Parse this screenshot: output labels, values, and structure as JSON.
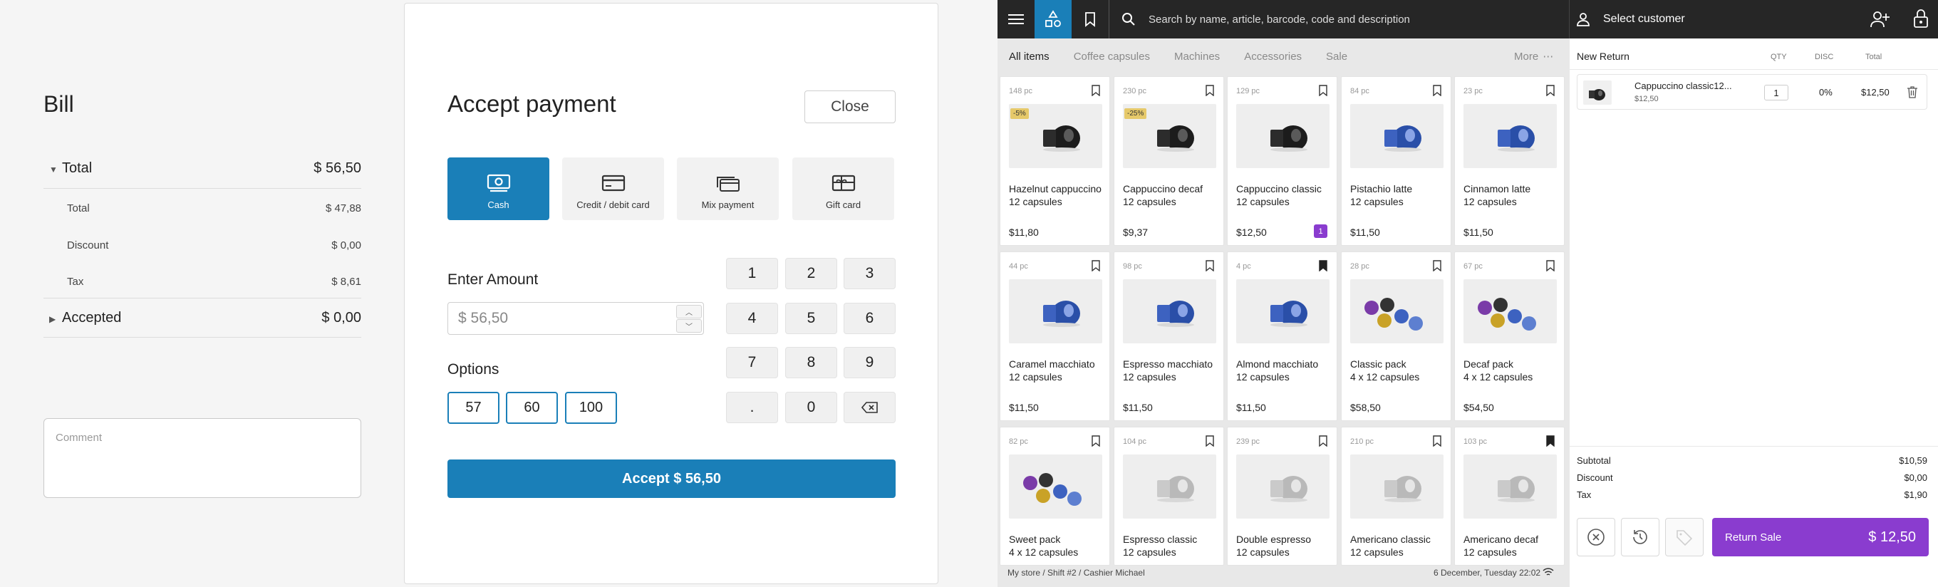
{
  "bill": {
    "title": "Bill",
    "total_label": "Total",
    "total_value": "$ 56,50",
    "rows": [
      {
        "label": "Total",
        "value": "$ 47,88"
      },
      {
        "label": "Discount",
        "value": "$ 0,00"
      },
      {
        "label": "Tax",
        "value": "$ 8,61"
      }
    ],
    "accepted_label": "Accepted",
    "accepted_value": "$ 0,00",
    "comment_placeholder": "Comment"
  },
  "payment": {
    "title": "Accept payment",
    "close_label": "Close",
    "methods": [
      {
        "label": "Cash",
        "icon": "cash-icon",
        "active": true
      },
      {
        "label": "Credit / debit card",
        "icon": "credit-card-icon",
        "active": false
      },
      {
        "label": "Mix payment",
        "icon": "mix-payment-icon",
        "active": false
      },
      {
        "label": "Gift card",
        "icon": "gift-card-icon",
        "active": false
      }
    ],
    "enter_amount_label": "Enter Amount",
    "amount_placeholder": "$ 56,50",
    "options_label": "Options",
    "options": [
      "57",
      "60",
      "100"
    ],
    "keys": [
      "1",
      "2",
      "3",
      "4",
      "5",
      "6",
      "7",
      "8",
      "9",
      ".",
      "0"
    ],
    "accept_label": "Accept $ 56,50"
  },
  "pos": {
    "search_placeholder": "Search by name, article, barcode, code and description",
    "select_customer": "Select customer",
    "tabs": [
      "All items",
      "Coffee capsules",
      "Machines",
      "Accessories",
      "Sale"
    ],
    "more_label": "More",
    "products": [
      {
        "stock": "148 pc",
        "name1": "Hazelnut cappuccino",
        "name2": "12 capsules",
        "price": "$11,80",
        "discount": "-5%",
        "bookmarked": false,
        "img": "dark"
      },
      {
        "stock": "230 pc",
        "name1": "Cappuccino decaf",
        "name2": "12 capsules",
        "price": "$9,37",
        "discount": "-25%",
        "bookmarked": false,
        "img": "dark"
      },
      {
        "stock": "129 pc",
        "name1": "Cappuccino classic",
        "name2": "12 capsules",
        "price": "$12,50",
        "qty": "1",
        "bookmarked": false,
        "img": "dark"
      },
      {
        "stock": "84 pc",
        "name1": "Pistachio latte",
        "name2": "12 capsules",
        "price": "$11,50",
        "bookmarked": false,
        "img": "blue"
      },
      {
        "stock": "23 pc",
        "name1": "Cinnamon latte",
        "name2": "12 capsules",
        "price": "$11,50",
        "bookmarked": false,
        "img": "blue"
      },
      {
        "stock": "44 pc",
        "name1": "Caramel macchiato",
        "name2": "12 capsules",
        "price": "$11,50",
        "bookmarked": false,
        "img": "blue"
      },
      {
        "stock": "98 pc",
        "name1": "Espresso macchiato",
        "name2": "12 capsules",
        "price": "$11,50",
        "bookmarked": false,
        "img": "blue"
      },
      {
        "stock": "4 pc",
        "name1": "Almond macchiato",
        "name2": "12 capsules",
        "price": "$11,50",
        "bookmarked": true,
        "img": "blue"
      },
      {
        "stock": "28 pc",
        "name1": "Classic pack",
        "name2": "4 x 12 capsules",
        "price": "$58,50",
        "bookmarked": false,
        "img": "pack"
      },
      {
        "stock": "67 pc",
        "name1": "Decaf pack",
        "name2": "4 x 12 capsules",
        "price": "$54,50",
        "bookmarked": false,
        "img": "pack"
      },
      {
        "stock": "82 pc",
        "name1": "Sweet pack",
        "name2": "4 x 12 capsules",
        "price": "",
        "bookmarked": false,
        "img": "pack"
      },
      {
        "stock": "104 pc",
        "name1": "Espresso classic",
        "name2": "12 capsules",
        "price": "",
        "bookmarked": false,
        "img": "silver"
      },
      {
        "stock": "239 pc",
        "name1": "Double espresso",
        "name2": "12 capsules",
        "price": "",
        "bookmarked": false,
        "img": "silver"
      },
      {
        "stock": "210 pc",
        "name1": "Americano classic",
        "name2": "12 capsules",
        "price": "",
        "bookmarked": false,
        "img": "silver"
      },
      {
        "stock": "103 pc",
        "name1": "Americano decaf",
        "name2": "12 capsules",
        "price": "",
        "bookmarked": true,
        "img": "silver"
      }
    ],
    "footer_left": "My store / Shift #2 / Cashier Michael",
    "footer_right": "6 December, Tuesday 22:02",
    "cart": {
      "title": "New Return",
      "col_qty": "QTY",
      "col_disc": "DISC",
      "col_total": "Total",
      "item": {
        "name": "Cappuccino classic12...",
        "price": "$12,50",
        "qty": "1",
        "disc": "0%",
        "total": "$12,50"
      },
      "subtotal_label": "Subtotal",
      "subtotal_value": "$10,59",
      "discount_label": "Discount",
      "discount_value": "$0,00",
      "tax_label": "Tax",
      "tax_value": "$1,90",
      "return_label": "Return Sale",
      "return_value": "$ 12,50"
    },
    "colors": {
      "accent": "#1a7fb8",
      "purple": "#8a3ccf",
      "dark": "#262626"
    }
  }
}
